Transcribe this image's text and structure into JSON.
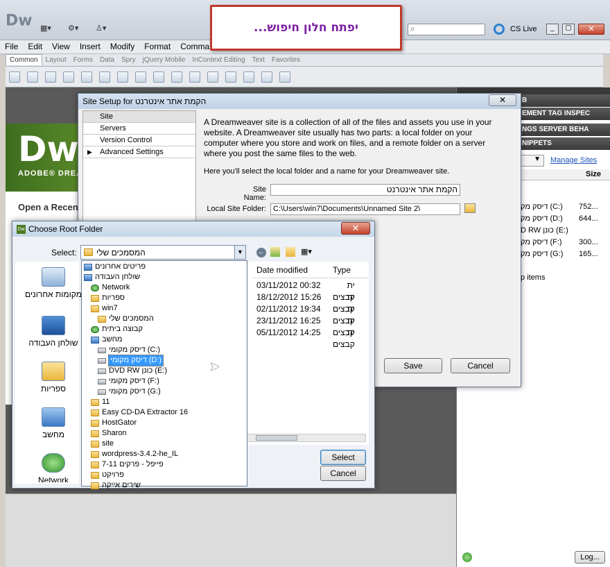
{
  "app": {
    "logo": "Dw",
    "cs_live": "CS Live",
    "menu": [
      "File",
      "Edit",
      "View",
      "Insert",
      "Modify",
      "Format",
      "Commar"
    ],
    "insert_tabs": [
      "Common",
      "Layout",
      "Forms",
      "Data",
      "Spry",
      "jQuery Mobile",
      "InContext Editing",
      "Text",
      "Favorites"
    ],
    "welcome": {
      "brand": "Dw",
      "brand_sub": "ADOBE® DREA",
      "open_recent": "Open a Recen"
    }
  },
  "annotation": {
    "text": "יפתח חלון חיפוש..."
  },
  "right_panel": {
    "tabs": [
      "B",
      "EMENT",
      "TAG INSPEC",
      "NGS",
      "SERVER BEHA",
      "NIPPETS"
    ],
    "manage_sites": "Manage Sites",
    "size_header": "Size",
    "rows": [
      {
        "name": "דיסק מק (C:)",
        "size": "752..."
      },
      {
        "name": "דיסק מק (D:)",
        "size": "644..."
      },
      {
        "name": "D RW כונן (E:)",
        "size": ""
      },
      {
        "name": "דיסק מק (F:)",
        "size": "300..."
      },
      {
        "name": "דיסק מק (G:)",
        "size": "165..."
      }
    ],
    "items_text": "p items",
    "log_button": "Log..."
  },
  "site_setup": {
    "title": "Site Setup for הקמת אתר אינטרנט",
    "nav": [
      "Site",
      "Servers",
      "Version Control",
      "Advanced Settings"
    ],
    "description": "A Dreamweaver site is a collection of all of the files and assets you use in your website. A Dreamweaver site usually has two parts: a local folder on your computer where you store and work on files, and a remote folder on a server where you post the same files to the web.",
    "hint": "Here you'll select the local folder and a name for your Dreamweaver site.",
    "site_name_label": "Site Name:",
    "site_name_value": "הקמת אתר אינטרנט",
    "local_folder_label": "Local Site Folder:",
    "local_folder_value": "C:\\Users\\win7\\Documents\\Unnamed Site 2\\",
    "save": "Save",
    "cancel": "Cancel"
  },
  "choose_root": {
    "title": "Choose Root Folder",
    "select_label": "Select:",
    "select_value": "המסמכים שלי",
    "places": [
      "מקומות אחרונים",
      "שולחן העבודה",
      "ספריות",
      "מחשב",
      "Network"
    ],
    "dropdown": [
      {
        "label": "פריטים אחרונים",
        "icon": "recent-icon",
        "indent": 0
      },
      {
        "label": "שולחן העבודה",
        "icon": "desktop-icon",
        "indent": 0
      },
      {
        "label": "Network",
        "icon": "network-icon",
        "indent": 1
      },
      {
        "label": "ספריות",
        "icon": "libraries-icon",
        "indent": 1
      },
      {
        "label": "win7",
        "icon": "user-icon",
        "indent": 1
      },
      {
        "label": "המסמכים שלי",
        "icon": "folder-icon",
        "indent": 2
      },
      {
        "label": "קבוצה ביתית",
        "icon": "homegroup-icon",
        "indent": 1
      },
      {
        "label": "מחשב",
        "icon": "computer-icon",
        "indent": 1
      },
      {
        "label": "דיסק מקומי (C:)",
        "icon": "drive-icon",
        "indent": 2
      },
      {
        "label": "דיסק מקומי (D:)",
        "icon": "drive-icon",
        "indent": 2,
        "selected": true
      },
      {
        "label": "DVD RW כונן (E:)",
        "icon": "dvd-icon",
        "indent": 2
      },
      {
        "label": "דיסק מקומי (F:)",
        "icon": "drive-icon",
        "indent": 2
      },
      {
        "label": "דיסק מקומי (G:)",
        "icon": "drive-icon",
        "indent": 2
      },
      {
        "label": "11",
        "icon": "folder-icon",
        "indent": 1
      },
      {
        "label": "Easy CD-DA Extractor 16",
        "icon": "folder-icon",
        "indent": 1
      },
      {
        "label": "HostGator",
        "icon": "folder-icon",
        "indent": 1
      },
      {
        "label": "Sharon",
        "icon": "folder-icon",
        "indent": 1
      },
      {
        "label": "site",
        "icon": "folder-icon",
        "indent": 1
      },
      {
        "label": "wordpress-3.4.2-he_IL",
        "icon": "folder-icon",
        "indent": 1
      },
      {
        "label": "פייפל - פרקים 7-11",
        "icon": "folder-icon",
        "indent": 1
      },
      {
        "label": "פרויקט",
        "icon": "folder-icon",
        "indent": 1
      },
      {
        "label": "שירים אייקה",
        "icon": "folder-icon",
        "indent": 1
      }
    ],
    "columns": [
      "Date modified",
      "Type"
    ],
    "rows": [
      {
        "date": "03/11/2012 00:32",
        "type": "ית קבצים"
      },
      {
        "date": "18/12/2012 15:26",
        "type": "ית קבצים"
      },
      {
        "date": "02/11/2012 19:34",
        "type": "ית קבצים"
      },
      {
        "date": "23/11/2012 16:25",
        "type": "ית קבצים"
      },
      {
        "date": "05/11/2012 14:25",
        "type": "ית קבצים"
      }
    ],
    "select_button": "Select",
    "cancel_button": "Cancel"
  }
}
